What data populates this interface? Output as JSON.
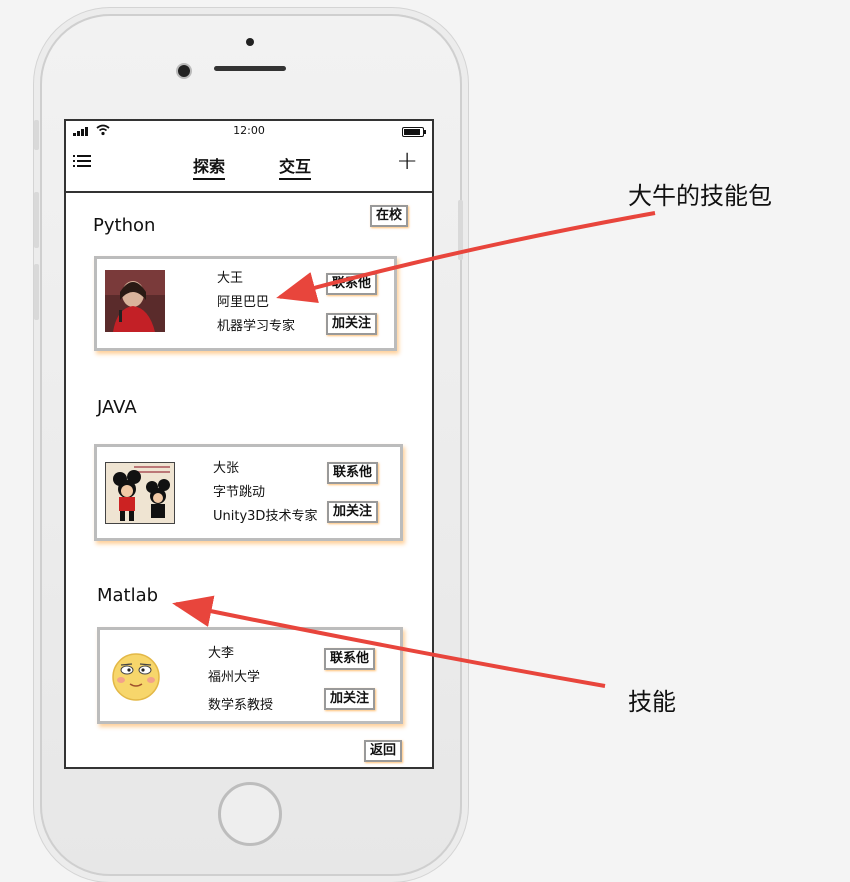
{
  "statusbar": {
    "time": "12:00"
  },
  "navbar": {
    "tabs": [
      "探索",
      "交互"
    ],
    "add_label": "+"
  },
  "status_button": "在校",
  "back_button": "返回",
  "sections": [
    {
      "title": "Python",
      "name": "大王",
      "company": "阿里巴巴",
      "title_role": "机器学习专家",
      "contact": "联系他",
      "follow": "加关注"
    },
    {
      "title": "JAVA",
      "name": "大张",
      "company": "字节跳动",
      "title_role": "Unity3D技术专家",
      "contact": "联系他",
      "follow": "加关注"
    },
    {
      "title": "Matlab",
      "name": "大李",
      "company": "福州大学",
      "title_role": "数学系教授",
      "contact": "联系他",
      "follow": "加关注"
    }
  ],
  "annotations": {
    "top": "大牛的技能包",
    "bottom": "技能"
  },
  "colors": {
    "arrow": "#e8453c",
    "card_shadow": "#ffa040"
  }
}
